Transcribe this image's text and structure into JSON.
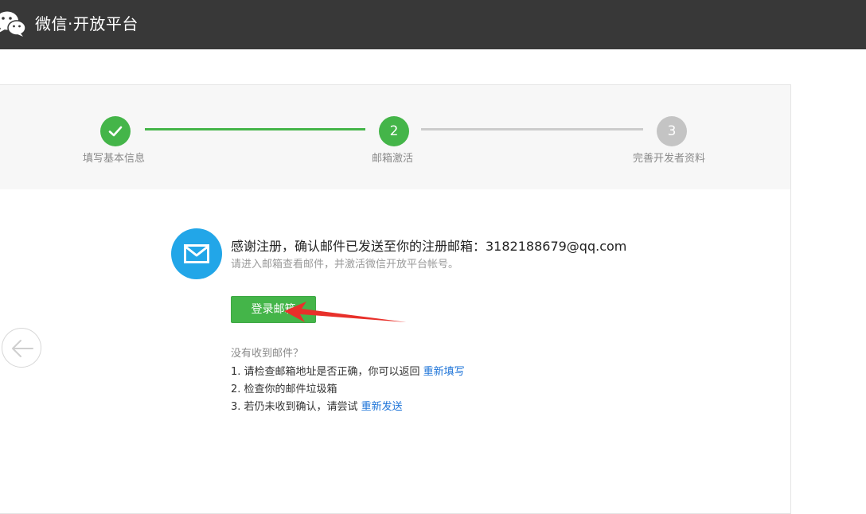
{
  "header": {
    "brand": "微信·开放平台",
    "logo_icon": "wechat-logo-icon"
  },
  "steps": [
    {
      "label": "填写基本信息",
      "state": "done",
      "icon": "check-icon"
    },
    {
      "label": "邮箱激活",
      "number": "2",
      "state": "current"
    },
    {
      "label": "完善开发者资料",
      "number": "3",
      "state": "pending"
    }
  ],
  "message": {
    "icon": "mail-icon",
    "title": "感谢注册，确认邮件已发送至你的注册邮箱：3182188679@qq.com",
    "subtitle": "请进入邮箱查看邮件，并激活微信开放平台帐号。"
  },
  "login_button": "登录邮箱",
  "help": {
    "title": "没有收到邮件？",
    "items": [
      {
        "text": "1. 请检查邮箱地址是否正确，你可以返回 ",
        "link": "重新填写"
      },
      {
        "text": "2. 检查你的邮件垃圾箱"
      },
      {
        "text": "3. 若仍未收到确认，请尝试 ",
        "link": "重新发送"
      }
    ]
  },
  "colors": {
    "header_bg": "#383838",
    "accent_green": "#44b549",
    "mail_blue": "#22a6e8",
    "link_blue": "#1e74d8",
    "annotation_red": "#e8302a"
  }
}
